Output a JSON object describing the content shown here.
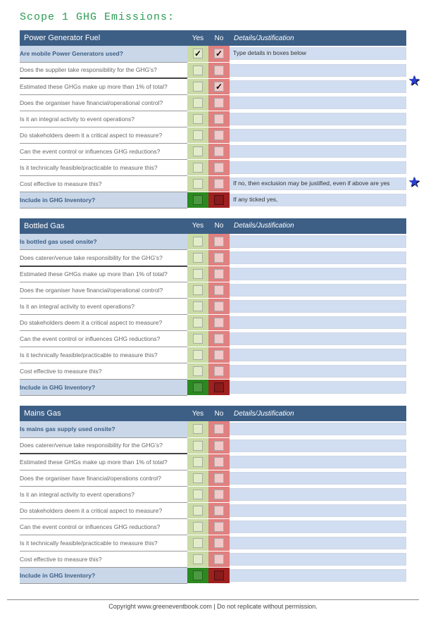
{
  "page_title": "Scope 1 GHG Emissions:",
  "columns": {
    "yes": "Yes",
    "no": "No",
    "details": "Details/Justification"
  },
  "sections": [
    {
      "title": "Power Generator Fuel",
      "rows": [
        {
          "q": "Are mobile Power Generators used?",
          "kind": "top",
          "yes": true,
          "no": true,
          "det": "Type details in boxes below"
        },
        {
          "q": "Does the supplier take responsibility for the GHG's?",
          "kind": "mid",
          "yes": false,
          "no": false,
          "det": "",
          "star": true,
          "divider": true
        },
        {
          "q": "Estimated these GHGs make up more than 1% of total?",
          "kind": "mid",
          "yes": false,
          "no": true,
          "det": ""
        },
        {
          "q": "Does the organiser have financial/operational control?",
          "kind": "mid",
          "yes": false,
          "no": false,
          "det": ""
        },
        {
          "q": "Is it an integral activity to event operations?",
          "kind": "mid",
          "yes": false,
          "no": false,
          "det": ""
        },
        {
          "q": "Do stakeholders deem it a critical aspect to measure?",
          "kind": "mid",
          "yes": false,
          "no": false,
          "det": ""
        },
        {
          "q": "Can the event control or influences GHG reductions?",
          "kind": "mid",
          "yes": false,
          "no": false,
          "det": ""
        },
        {
          "q": "Is it technically feasible/practicable to measure this?",
          "kind": "mid",
          "yes": false,
          "no": false,
          "det": "",
          "star": true
        },
        {
          "q": "Cost effective to measure this?",
          "kind": "mid",
          "yes": false,
          "no": false,
          "det": "If no, then exclusion may be justified, even if above are yes"
        },
        {
          "q": "Include in GHG Inventory?",
          "kind": "bottom",
          "summary": true,
          "det": "If any ticked yes,"
        }
      ]
    },
    {
      "title": "Bottled Gas",
      "rows": [
        {
          "q": "Is bottled gas used onsite?",
          "kind": "top",
          "yes": false,
          "no": false,
          "det": ""
        },
        {
          "q": "Does caterer/venue take responsibility for the GHG's?",
          "kind": "mid",
          "yes": false,
          "no": false,
          "det": "",
          "divider": true
        },
        {
          "q": "Estimated these GHGs make up more than 1% of total?",
          "kind": "mid",
          "yes": false,
          "no": false,
          "det": ""
        },
        {
          "q": "Does the organiser have financial/operational control?",
          "kind": "mid",
          "yes": false,
          "no": false,
          "det": ""
        },
        {
          "q": "Is it an integral activity to event operations?",
          "kind": "mid",
          "yes": false,
          "no": false,
          "det": ""
        },
        {
          "q": "Do stakeholders deem it a critical aspect to measure?",
          "kind": "mid",
          "yes": false,
          "no": false,
          "det": ""
        },
        {
          "q": "Can the event control or influences GHG reductions?",
          "kind": "mid",
          "yes": false,
          "no": false,
          "det": ""
        },
        {
          "q": "Is it technically feasible/practicable to measure this?",
          "kind": "mid",
          "yes": false,
          "no": false,
          "det": ""
        },
        {
          "q": "Cost effective to measure this?",
          "kind": "mid",
          "yes": false,
          "no": false,
          "det": ""
        },
        {
          "q": "Include in GHG Inventory?",
          "kind": "bottom",
          "summary": true,
          "det": ""
        }
      ]
    },
    {
      "title": "Mains Gas",
      "rows": [
        {
          "q": "Is mains gas supply used onsite?",
          "kind": "top",
          "yes": false,
          "no": false,
          "det": ""
        },
        {
          "q": "Does caterer/venue take responsibility for the GHG's?",
          "kind": "mid",
          "yes": false,
          "no": false,
          "det": "",
          "divider": true
        },
        {
          "q": "Estimated these GHGs make up more than 1% of total?",
          "kind": "mid",
          "yes": false,
          "no": false,
          "det": ""
        },
        {
          "q": "Does the organiser have financial/operations control?",
          "kind": "mid",
          "yes": false,
          "no": false,
          "det": ""
        },
        {
          "q": "Is it an integral activity to event operations?",
          "kind": "mid",
          "yes": false,
          "no": false,
          "det": ""
        },
        {
          "q": "Do stakeholders deem it a critical aspect to measure?",
          "kind": "mid",
          "yes": false,
          "no": false,
          "det": ""
        },
        {
          "q": "Can the event control or influences GHG reductions?",
          "kind": "mid",
          "yes": false,
          "no": false,
          "det": ""
        },
        {
          "q": "Is it technically feasible/practicable to measure this?",
          "kind": "mid",
          "yes": false,
          "no": false,
          "det": ""
        },
        {
          "q": "Cost effective to measure this?",
          "kind": "mid",
          "yes": false,
          "no": false,
          "det": ""
        },
        {
          "q": "Include in GHG Inventory?",
          "kind": "bottom",
          "summary": true,
          "det": ""
        }
      ]
    }
  ],
  "star_positions": [
    102,
    246
  ],
  "footer": "Copyright www.greeneventbook.com | Do not replicate without permission."
}
